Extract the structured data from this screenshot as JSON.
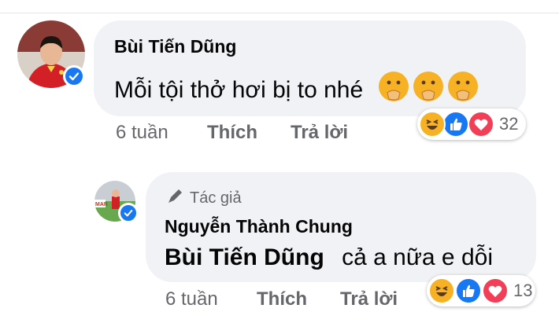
{
  "comments": [
    {
      "author": "Bùi Tiến Dũng",
      "text": "Mỗi tội thở hơi bị to nhé",
      "emoji": "shushing-face",
      "time": "6 tuần",
      "like_label": "Thích",
      "reply_label": "Trả lời",
      "reaction_count": "32",
      "reactions": [
        "haha",
        "like",
        "love"
      ]
    },
    {
      "badge": "Tác giả",
      "author": "Nguyễn Thành Chung",
      "mention": "Bùi Tiến Dũng",
      "text": "cả a nữa e dỗi",
      "time": "6 tuần",
      "like_label": "Thích",
      "reply_label": "Trả lời",
      "reaction_count": "13",
      "reactions": [
        "haha",
        "like",
        "love"
      ]
    }
  ],
  "colors": {
    "bubble": "#f0f2f5",
    "like": "#1877f2",
    "love": "#f33e58",
    "haha": "#f7b125",
    "secondary_text": "#65676b"
  }
}
